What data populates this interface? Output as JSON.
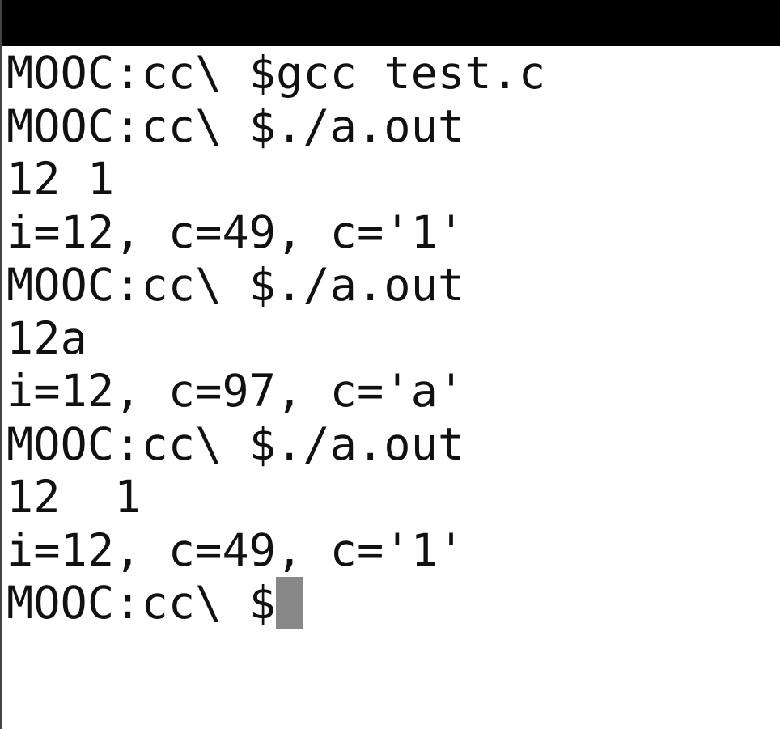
{
  "terminal": {
    "lines": [
      "MOOC:cc\\ $gcc test.c",
      "MOOC:cc\\ $./a.out",
      "12 1",
      "i=12, c=49, c='1'",
      "MOOC:cc\\ $./a.out",
      "12a",
      "i=12, c=97, c='a'",
      "MOOC:cc\\ $./a.out",
      "12  1",
      "i=12, c=49, c='1'"
    ],
    "prompt": "MOOC:cc\\ $"
  }
}
